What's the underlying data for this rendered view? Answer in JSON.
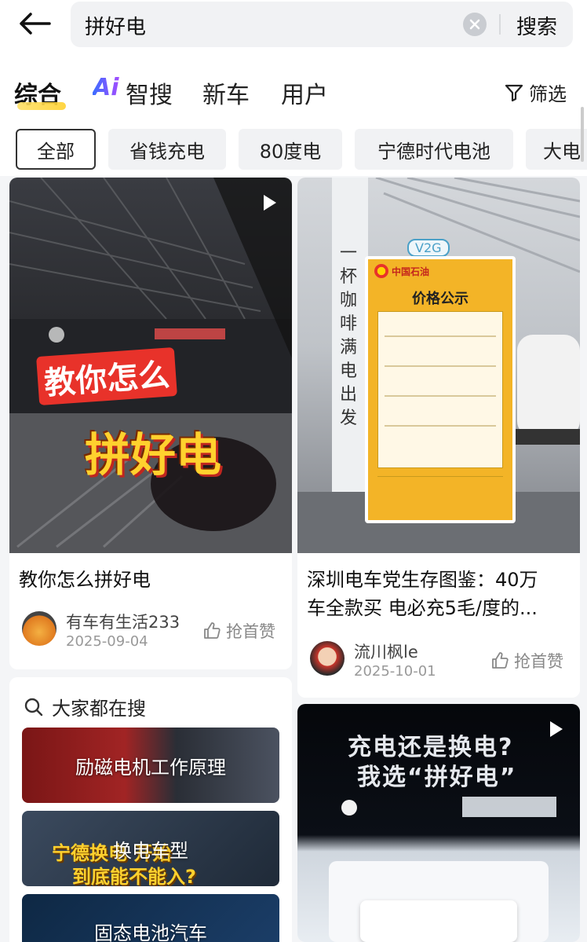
{
  "search": {
    "query": "拼好电",
    "button": "搜索"
  },
  "tabs": [
    {
      "label": "综合"
    },
    {
      "label": "智搜",
      "badge": "Ai"
    },
    {
      "label": "新车"
    },
    {
      "label": "用户"
    }
  ],
  "filter_label": "筛选",
  "chips": [
    "全部",
    "省钱充电",
    "80度电",
    "宁德时代电池",
    "大电"
  ],
  "cards": {
    "left1": {
      "overlay_line1": "教你怎么",
      "overlay_line2": "拼好电",
      "title": "教你怎么拼好电",
      "author": "有车有生活233",
      "date": "2025-09-04",
      "like": "抢首赞"
    },
    "right1": {
      "brand": "中国石油",
      "board_title": "价格公示",
      "poster_text": "一杯咖啡满电出发",
      "badge": "V2G",
      "title_line1": "深圳电车党生存图鉴：40万",
      "title_line2": "车全款买 电必充5毛/度的...",
      "author": "流川枫le",
      "date": "2025-10-01",
      "like": "抢首赞"
    },
    "right2": {
      "overlay_line1": "充电还是换电?",
      "overlay_line2": "我选“拼好电”"
    }
  },
  "hot": {
    "title": "大家都在搜",
    "items": [
      "励磁电机工作原理",
      "换电车型",
      "固态电池汽车"
    ],
    "bg_text_line1": "宁德换电 开始",
    "bg_text_line2": "到底能不能入?"
  },
  "colors": {
    "accent_yellow": "#ffd12e",
    "overlay_red": "#e8322a"
  }
}
